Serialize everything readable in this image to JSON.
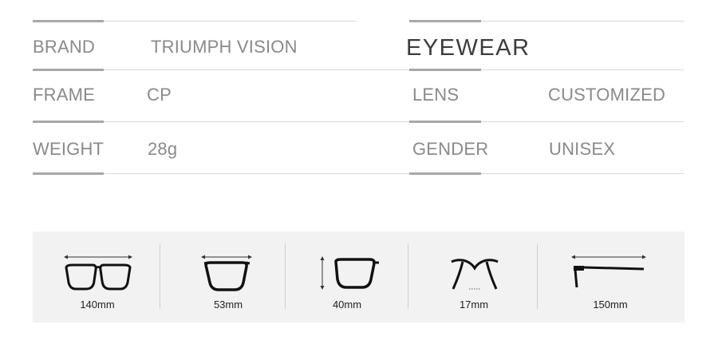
{
  "specs": {
    "brand_label": "BRAND",
    "brand_value": "TRIUMPH VISION",
    "category": "EYEWEAR",
    "frame_label": "FRAME",
    "frame_value": "CP",
    "lens_label": "LENS",
    "lens_value": "CUSTOMIZED",
    "weight_label": "WEIGHT",
    "weight_value": "28g",
    "gender_label": "GENDER",
    "gender_value": "UNISEX"
  },
  "dimensions": [
    {
      "icon": "frame-width-icon",
      "label": "140mm"
    },
    {
      "icon": "lens-width-icon",
      "label": "53mm"
    },
    {
      "icon": "lens-height-icon",
      "label": "40mm"
    },
    {
      "icon": "bridge-width-icon",
      "label": "17mm"
    },
    {
      "icon": "temple-length-icon",
      "label": "150mm"
    }
  ],
  "colors": {
    "text": "#8a8a8a",
    "accent_bar": "#a8a8a8",
    "rule": "#d9d9d9",
    "panel_bg": "#f2f2f2"
  }
}
